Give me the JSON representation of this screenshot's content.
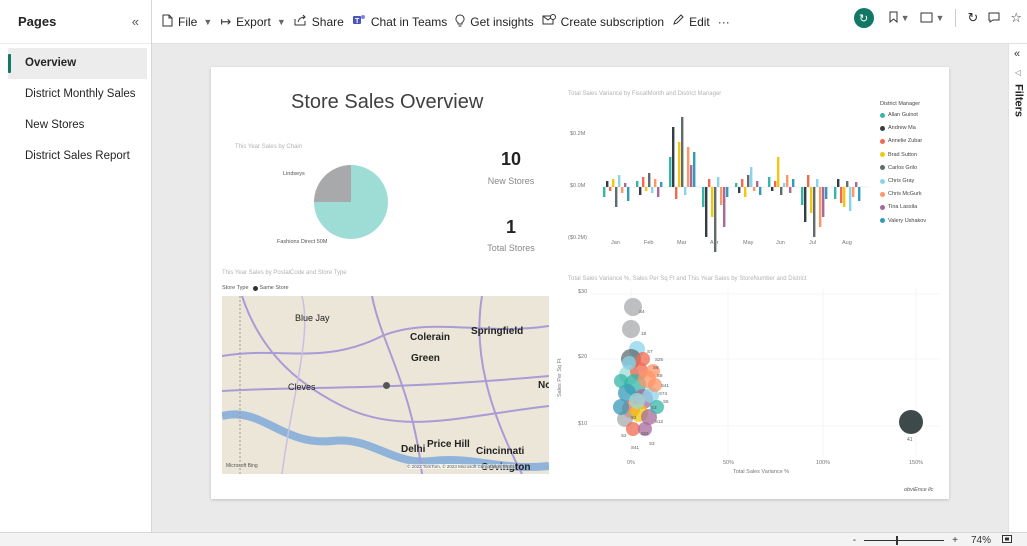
{
  "pages_pane": {
    "title": "Pages",
    "collapse_glyph": "«",
    "items": [
      {
        "label": "Overview",
        "active": true
      },
      {
        "label": "District Monthly Sales",
        "active": false
      },
      {
        "label": "New Stores",
        "active": false
      },
      {
        "label": "District Sales Report",
        "active": false
      }
    ]
  },
  "toolbar": {
    "file": "File",
    "export": "Export",
    "share": "Share",
    "chat": "Chat in Teams",
    "insights": "Get insights",
    "subscription": "Create subscription",
    "edit": "Edit",
    "more": "···"
  },
  "report": {
    "title": "Store Sales Overview",
    "pie": {
      "title": "This Year Sales by Chain",
      "label_top": "Lindseys",
      "label_bottom": "Fashions Direct 50M",
      "slices": [
        {
          "name": "Fashions Direct",
          "fraction": 0.75,
          "color": "#9edcd6"
        },
        {
          "name": "Lindseys",
          "fraction": 0.25,
          "color": "#a7a9ab"
        }
      ]
    },
    "kpi_new": {
      "value": "10",
      "label": "New Stores"
    },
    "kpi_total": {
      "value": "1",
      "label": "Total Stores"
    },
    "variance_chart": {
      "title": "Total Sales Variance by FiscalMonth and District Manager",
      "y_ticks": [
        "$0.2M",
        "$0.0M",
        "($0.2M)"
      ],
      "months": [
        "Jan",
        "Feb",
        "Mar",
        "Apr",
        "May",
        "Jun",
        "Jul",
        "Aug"
      ],
      "legend_title": "District Manager",
      "legend": [
        {
          "name": "Allan Guinot",
          "color": "#36b5a8"
        },
        {
          "name": "Andrew Ma",
          "color": "#333d43"
        },
        {
          "name": "Annelie Zubar",
          "color": "#f06a50"
        },
        {
          "name": "Brad Sutton",
          "color": "#f2c80f"
        },
        {
          "name": "Carlos Grilo",
          "color": "#5f6b6d"
        },
        {
          "name": "Chris Gray",
          "color": "#8ad4eb"
        },
        {
          "name": "Chris McGurk",
          "color": "#fe9666"
        },
        {
          "name": "Tina Lassila",
          "color": "#a66999"
        },
        {
          "name": "Valery Ushakov",
          "color": "#3599b8"
        }
      ]
    },
    "map": {
      "title": "This Year Sales by PostalCode and Store Type",
      "legend_label": "Store Type",
      "legend_value": "Same Store",
      "places": [
        {
          "name": "Blue Jay",
          "bold": false
        },
        {
          "name": "Colerain",
          "bold": true
        },
        {
          "name": "Springfield",
          "bold": true
        },
        {
          "name": "Green",
          "bold": true
        },
        {
          "name": "Cleves",
          "bold": false
        },
        {
          "name": "Delhi",
          "bold": true
        },
        {
          "name": "Price Hill",
          "bold": true
        },
        {
          "name": "Cincinnati",
          "bold": true
        },
        {
          "name": "Covington",
          "bold": true
        },
        {
          "name": "No",
          "bold": true
        }
      ],
      "credit": "© 2022 TomTom, © 2023 Microsoft Corporation Terms",
      "brand": "Microsoft Bing"
    },
    "scatter": {
      "title": "Total Sales Variance %, Sales Per Sq Ft and This Year Sales by StoreNumber and District",
      "y_label": "Sales Per Sq Ft",
      "x_label": "Total Sales Variance %",
      "y_ticks": [
        "$30",
        "$20",
        "$10"
      ],
      "x_ticks": [
        "0%",
        "50%",
        "100%",
        "150%"
      ],
      "point_labels": [
        "S4",
        "18",
        "S7",
        "S25",
        "S6",
        "S8",
        "S41",
        "S74",
        "S5",
        "S3",
        "S2",
        "S51",
        "S12",
        "S2",
        "S41",
        "S3"
      ],
      "outlier_label": "41"
    },
    "footer_logo": "obviEnce llc"
  },
  "filters": {
    "label": "Filters",
    "collapse_glyph": "«"
  },
  "status": {
    "zoom_minus": "-",
    "zoom_plus": "+",
    "zoom_value": "74%"
  }
}
